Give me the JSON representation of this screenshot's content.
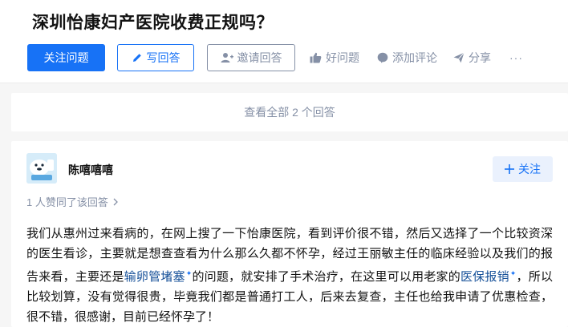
{
  "question": {
    "title": "深圳怡康妇产医院收费正规吗？",
    "follow_button": "关注问题",
    "write_button": "写回答",
    "invite_button": "邀请回答",
    "good_question": "好问题",
    "add_comment": "添加评论",
    "share": "分享",
    "more": "···"
  },
  "view_all": "查看全部 2 个回答",
  "answer": {
    "author": "陈嘻嘻嘻",
    "follow_button": "关注",
    "votes": "1 人赞同了该回答",
    "content": {
      "p1": "我们从惠州过来看病的，在网上搜了一下怡康医院，看到评价很不错，然后又选择了一个比较资深的医生看诊，主要就是想查查看为什么那么久都不怀孕，经过王丽敏主任的临床经验以及我们的报告来看，主要还是",
      "kw1": "输卵管堵塞",
      "p2": "的问题，就安排了手术治疗，在这里可以用老家的",
      "kw2": "医保报销",
      "p3": "，所以比较划算，没有觉得很贵，毕竟我们都是普通打工人，后来去复查，主任也给我申请了优惠检查，很不错，很感谢，目前已经怀孕了！",
      "kw_mark": "✦"
    }
  },
  "colors": {
    "primary": "#1772f6",
    "muted": "#8590a6",
    "link": "#175199",
    "background": "#f6f6f6"
  }
}
